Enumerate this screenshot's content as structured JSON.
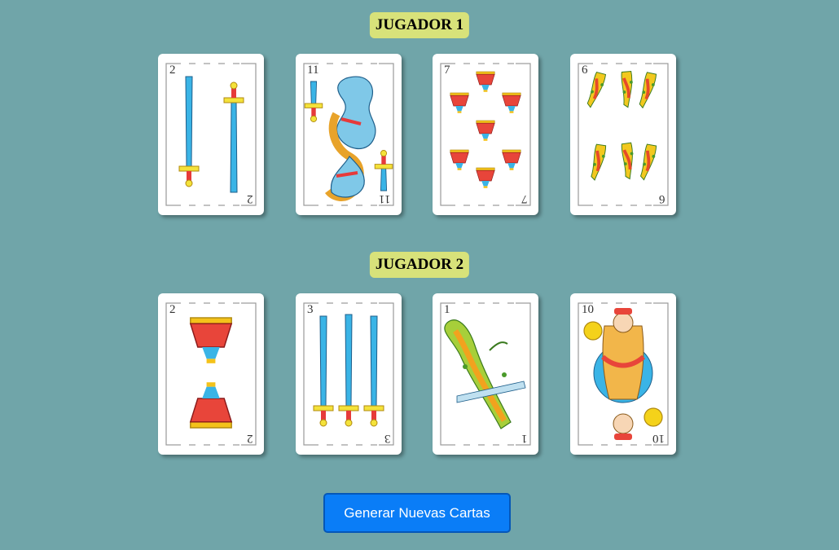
{
  "players": [
    {
      "title": "JUGADOR 1",
      "cards": [
        {
          "rank": "2",
          "suit": "espadas",
          "suit_icon": "sword-icon"
        },
        {
          "rank": "11",
          "suit": "espadas",
          "suit_icon": "horse-knight-icon"
        },
        {
          "rank": "7",
          "suit": "copas",
          "suit_icon": "cup-icon"
        },
        {
          "rank": "6",
          "suit": "bastos",
          "suit_icon": "club-icon"
        }
      ]
    },
    {
      "title": "JUGADOR 2",
      "cards": [
        {
          "rank": "2",
          "suit": "copas",
          "suit_icon": "cup-icon"
        },
        {
          "rank": "3",
          "suit": "espadas",
          "suit_icon": "sword-icon"
        },
        {
          "rank": "1",
          "suit": "bastos",
          "suit_icon": "club-icon"
        },
        {
          "rank": "10",
          "suit": "oros",
          "suit_icon": "king-coin-icon"
        }
      ]
    }
  ],
  "button": {
    "label": "Generar Nuevas Cartas"
  },
  "colors": {
    "background": "#70a5a9",
    "title_bg": "#d8e27a",
    "button": "#0a7df7"
  }
}
